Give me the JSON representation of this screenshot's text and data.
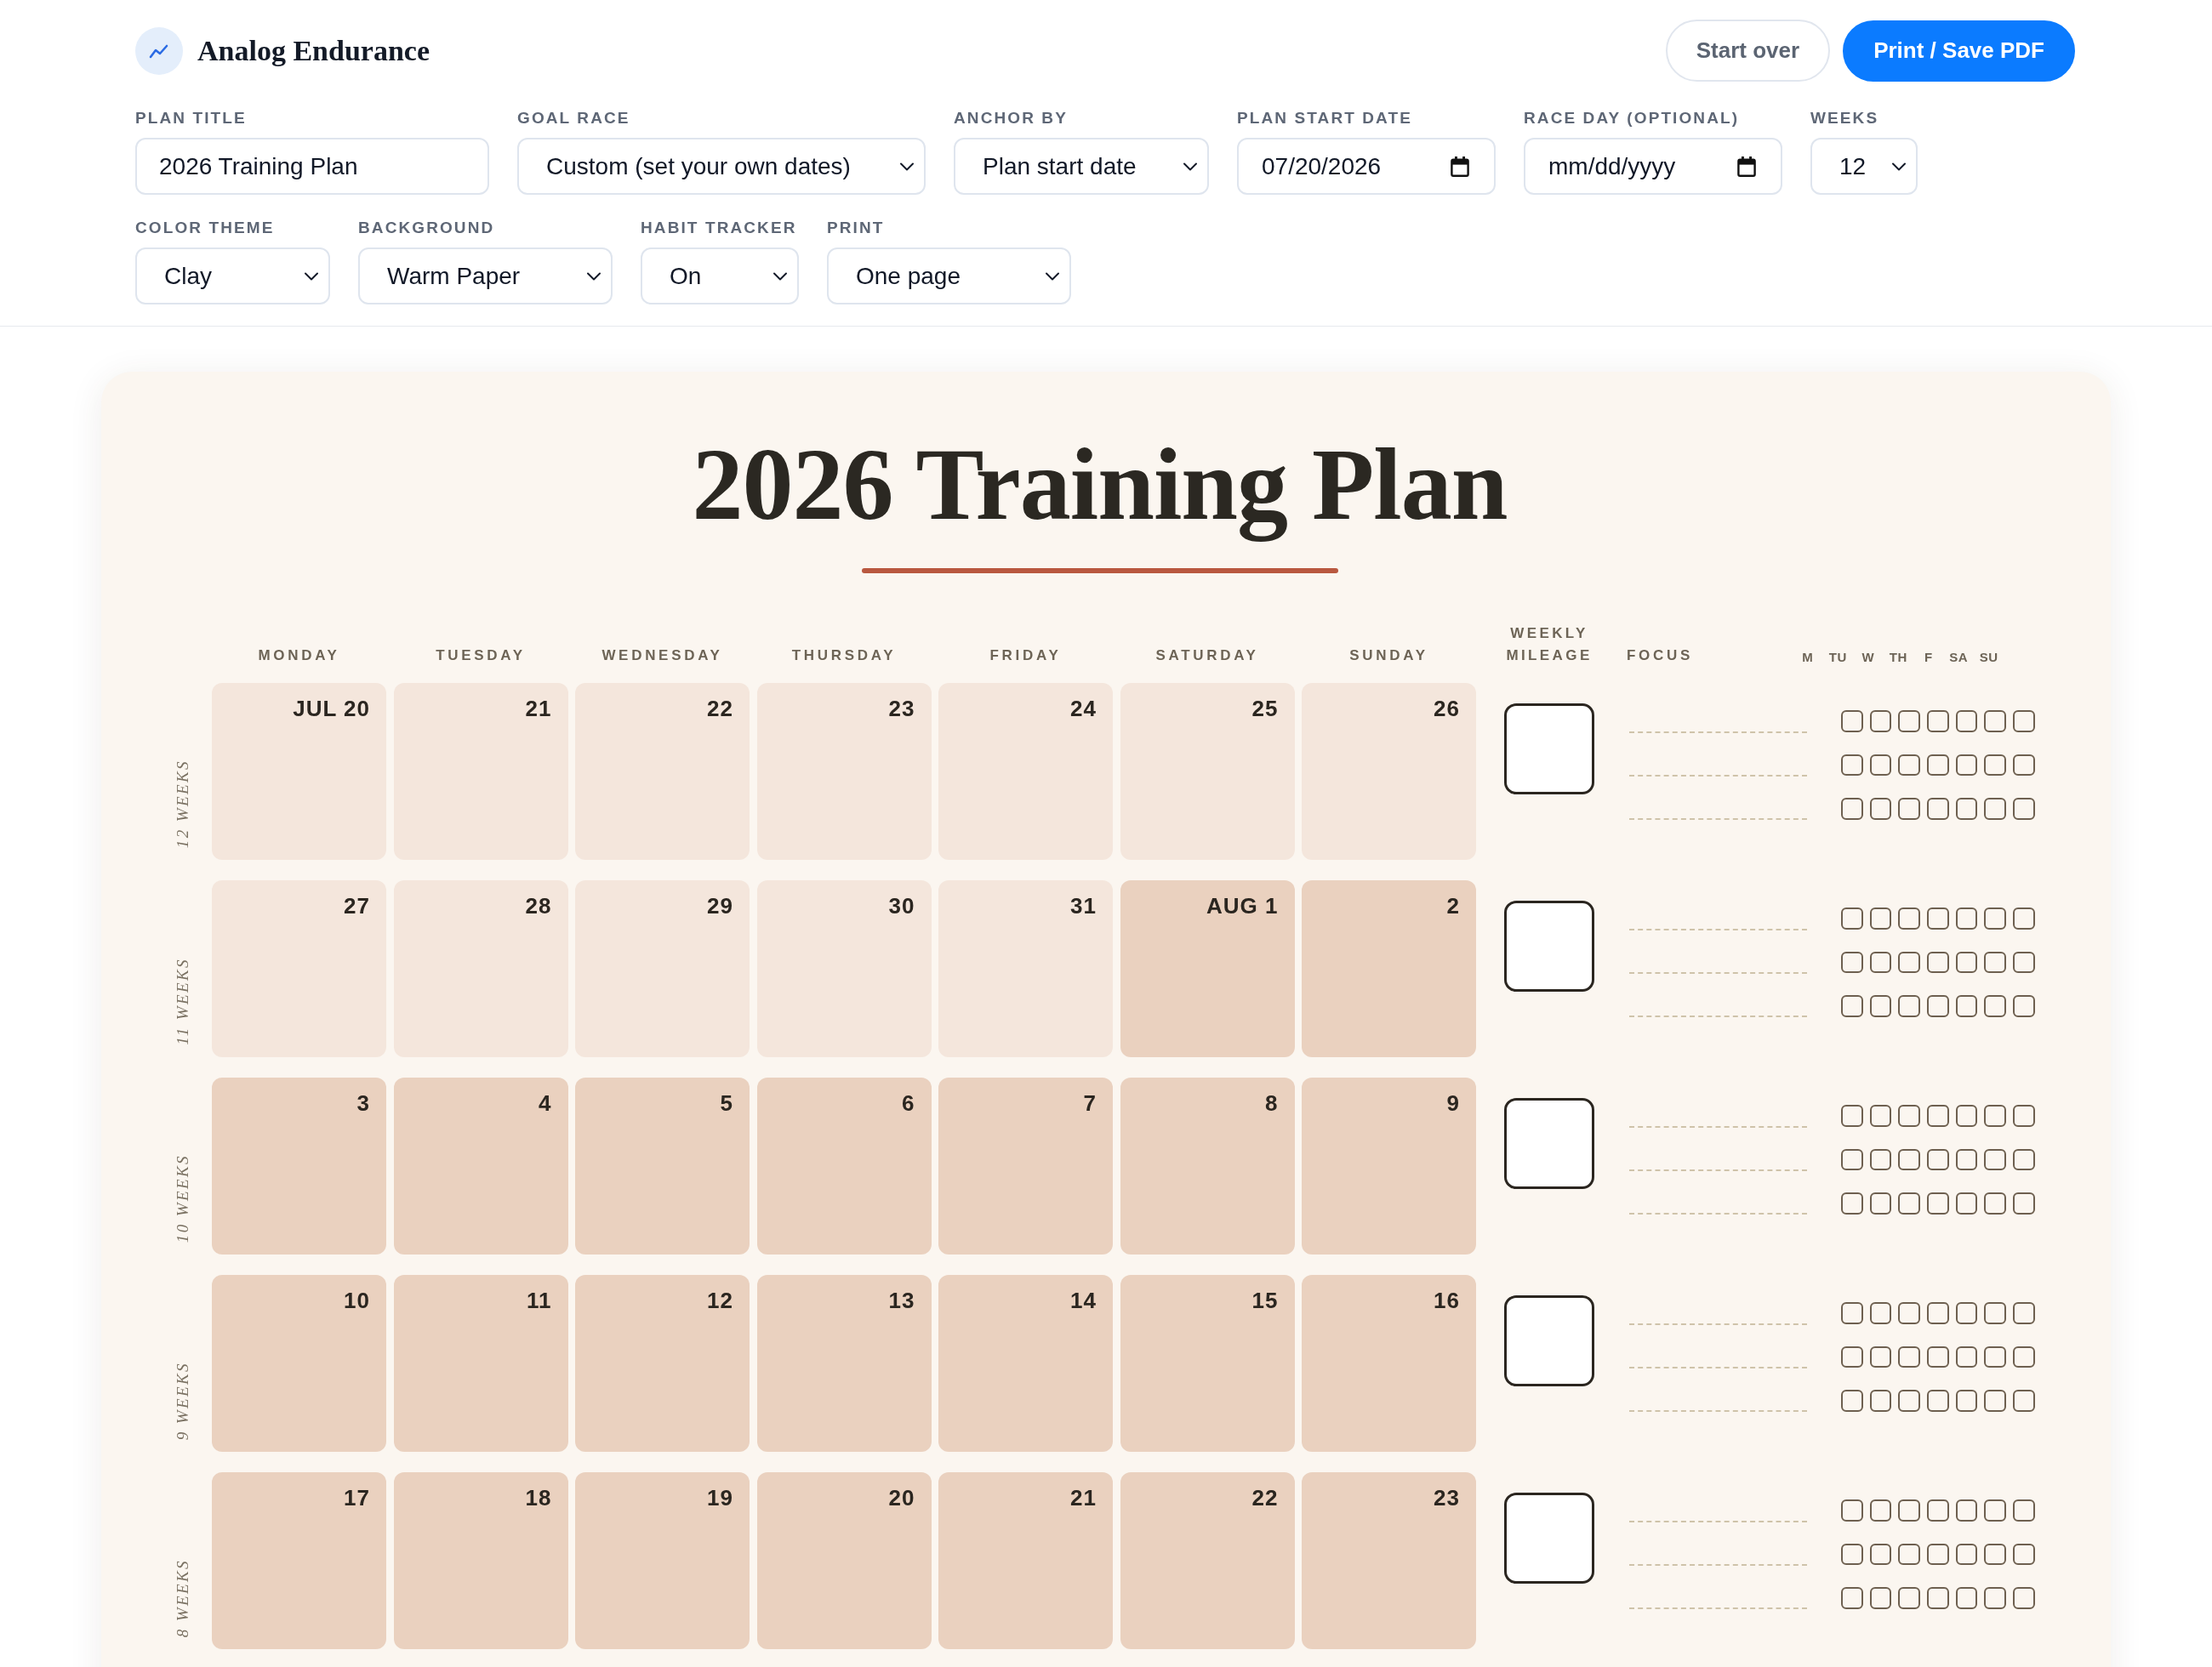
{
  "app": {
    "name": "Analog Endurance"
  },
  "actions": [
    {
      "label": "Start over",
      "kind": "secondary"
    },
    {
      "label": "Print / Save PDF",
      "kind": "primary"
    }
  ],
  "settings": [
    {
      "fields": [
        {
          "label": "PLAN TITLE",
          "kind": "text",
          "value": "2026 Training Plan"
        },
        {
          "label": "GOAL RACE",
          "kind": "select",
          "value": "Custom (set your own dates)"
        },
        {
          "label": "ANCHOR BY",
          "kind": "select",
          "value": "Plan start date"
        },
        {
          "label": "PLAN START DATE",
          "kind": "date",
          "value": "07/20/2026"
        },
        {
          "label": "RACE DAY (OPTIONAL)",
          "kind": "date",
          "placeholder": "mm/dd/yyyy"
        },
        {
          "label": "WEEKS",
          "kind": "select",
          "value": "12"
        }
      ]
    },
    {
      "fields": [
        {
          "label": "COLOR THEME",
          "kind": "select",
          "value": "Clay"
        },
        {
          "label": "BACKGROUND",
          "kind": "select",
          "value": "Warm Paper"
        },
        {
          "label": "HABIT TRACKER",
          "kind": "select",
          "value": "On"
        },
        {
          "label": "PRINT",
          "kind": "select",
          "value": "One page"
        }
      ]
    }
  ],
  "plan": {
    "title": "2026 Training Plan",
    "weekdays": [
      "MONDAY",
      "TUESDAY",
      "WEDNESDAY",
      "THURSDAY",
      "FRIDAY",
      "SATURDAY",
      "SUNDAY"
    ],
    "mileage_heading": "WEEKLY MILEAGE",
    "focus_heading": "FOCUS",
    "habit_days": [
      "M",
      "TU",
      "W",
      "TH",
      "F",
      "SA",
      "SU"
    ],
    "weeks": [
      {
        "label": "12 WEEKS",
        "days": [
          {
            "date": "JUL 20",
            "color": "#f4e6dc"
          },
          {
            "date": "21",
            "color": "#f4e6dc"
          },
          {
            "date": "22",
            "color": "#f4e6dc"
          },
          {
            "date": "23",
            "color": "#f4e6dc"
          },
          {
            "date": "24",
            "color": "#f4e6dc"
          },
          {
            "date": "25",
            "color": "#f4e6dc"
          },
          {
            "date": "26",
            "color": "#f4e6dc"
          }
        ],
        "habit_rows": [
          {
            "boxes": [
              {
                "checked": false
              },
              {
                "checked": false
              },
              {
                "checked": false
              },
              {
                "checked": false
              },
              {
                "checked": false
              },
              {
                "checked": false
              },
              {
                "checked": false
              }
            ]
          },
          {
            "boxes": [
              {
                "checked": false
              },
              {
                "checked": false
              },
              {
                "checked": false
              },
              {
                "checked": false
              },
              {
                "checked": false
              },
              {
                "checked": false
              },
              {
                "checked": false
              }
            ]
          },
          {
            "boxes": [
              {
                "checked": false
              },
              {
                "checked": false
              },
              {
                "checked": false
              },
              {
                "checked": false
              },
              {
                "checked": false
              },
              {
                "checked": false
              },
              {
                "checked": false
              }
            ]
          }
        ]
      },
      {
        "label": "11 WEEKS",
        "days": [
          {
            "date": "27",
            "color": "#f4e6dc"
          },
          {
            "date": "28",
            "color": "#f4e6dc"
          },
          {
            "date": "29",
            "color": "#f4e6dc"
          },
          {
            "date": "30",
            "color": "#f4e6dc"
          },
          {
            "date": "31",
            "color": "#f4e6dc"
          },
          {
            "date": "AUG 1",
            "color": "#ead1bf"
          },
          {
            "date": "2",
            "color": "#ead1bf"
          }
        ],
        "habit_rows": [
          {
            "boxes": [
              {
                "checked": false
              },
              {
                "checked": false
              },
              {
                "checked": false
              },
              {
                "checked": false
              },
              {
                "checked": false
              },
              {
                "checked": false
              },
              {
                "checked": false
              }
            ]
          },
          {
            "boxes": [
              {
                "checked": false
              },
              {
                "checked": false
              },
              {
                "checked": false
              },
              {
                "checked": false
              },
              {
                "checked": false
              },
              {
                "checked": false
              },
              {
                "checked": false
              }
            ]
          },
          {
            "boxes": [
              {
                "checked": false
              },
              {
                "checked": false
              },
              {
                "checked": false
              },
              {
                "checked": false
              },
              {
                "checked": false
              },
              {
                "checked": false
              },
              {
                "checked": false
              }
            ]
          }
        ]
      },
      {
        "label": "10 WEEKS",
        "days": [
          {
            "date": "3",
            "color": "#ead1bf"
          },
          {
            "date": "4",
            "color": "#ead1bf"
          },
          {
            "date": "5",
            "color": "#ead1bf"
          },
          {
            "date": "6",
            "color": "#ead1bf"
          },
          {
            "date": "7",
            "color": "#ead1bf"
          },
          {
            "date": "8",
            "color": "#ead1bf"
          },
          {
            "date": "9",
            "color": "#ead1bf"
          }
        ],
        "habit_rows": [
          {
            "boxes": [
              {
                "checked": false
              },
              {
                "checked": false
              },
              {
                "checked": false
              },
              {
                "checked": false
              },
              {
                "checked": false
              },
              {
                "checked": false
              },
              {
                "checked": false
              }
            ]
          },
          {
            "boxes": [
              {
                "checked": false
              },
              {
                "checked": false
              },
              {
                "checked": false
              },
              {
                "checked": false
              },
              {
                "checked": false
              },
              {
                "checked": false
              },
              {
                "checked": false
              }
            ]
          },
          {
            "boxes": [
              {
                "checked": false
              },
              {
                "checked": false
              },
              {
                "checked": false
              },
              {
                "checked": false
              },
              {
                "checked": false
              },
              {
                "checked": false
              },
              {
                "checked": false
              }
            ]
          }
        ]
      },
      {
        "label": "9 WEEKS",
        "days": [
          {
            "date": "10",
            "color": "#ead1bf"
          },
          {
            "date": "11",
            "color": "#ead1bf"
          },
          {
            "date": "12",
            "color": "#ead1bf"
          },
          {
            "date": "13",
            "color": "#ead1bf"
          },
          {
            "date": "14",
            "color": "#ead1bf"
          },
          {
            "date": "15",
            "color": "#ead1bf"
          },
          {
            "date": "16",
            "color": "#ead1bf"
          }
        ],
        "habit_rows": [
          {
            "boxes": [
              {
                "checked": false
              },
              {
                "checked": false
              },
              {
                "checked": false
              },
              {
                "checked": false
              },
              {
                "checked": false
              },
              {
                "checked": false
              },
              {
                "checked": false
              }
            ]
          },
          {
            "boxes": [
              {
                "checked": false
              },
              {
                "checked": false
              },
              {
                "checked": false
              },
              {
                "checked": false
              },
              {
                "checked": false
              },
              {
                "checked": false
              },
              {
                "checked": false
              }
            ]
          },
          {
            "boxes": [
              {
                "checked": false
              },
              {
                "checked": false
              },
              {
                "checked": false
              },
              {
                "checked": false
              },
              {
                "checked": false
              },
              {
                "checked": false
              },
              {
                "checked": false
              }
            ]
          }
        ]
      },
      {
        "label": "8 WEEKS",
        "days": [
          {
            "date": "17",
            "color": "#ead1bf"
          },
          {
            "date": "18",
            "color": "#ead1bf"
          },
          {
            "date": "19",
            "color": "#ead1bf"
          },
          {
            "date": "20",
            "color": "#ead1bf"
          },
          {
            "date": "21",
            "color": "#ead1bf"
          },
          {
            "date": "22",
            "color": "#ead1bf"
          },
          {
            "date": "23",
            "color": "#ead1bf"
          }
        ],
        "habit_rows": [
          {
            "boxes": [
              {
                "checked": false
              },
              {
                "checked": false
              },
              {
                "checked": false
              },
              {
                "checked": false
              },
              {
                "checked": false
              },
              {
                "checked": false
              },
              {
                "checked": false
              }
            ]
          },
          {
            "boxes": [
              {
                "checked": false
              },
              {
                "checked": false
              },
              {
                "checked": false
              },
              {
                "checked": false
              },
              {
                "checked": false
              },
              {
                "checked": false
              },
              {
                "checked": false
              }
            ]
          },
          {
            "boxes": [
              {
                "checked": false
              },
              {
                "checked": false
              },
              {
                "checked": false
              },
              {
                "checked": false
              },
              {
                "checked": false
              },
              {
                "checked": false
              },
              {
                "checked": false
              }
            ]
          }
        ]
      }
    ]
  }
}
